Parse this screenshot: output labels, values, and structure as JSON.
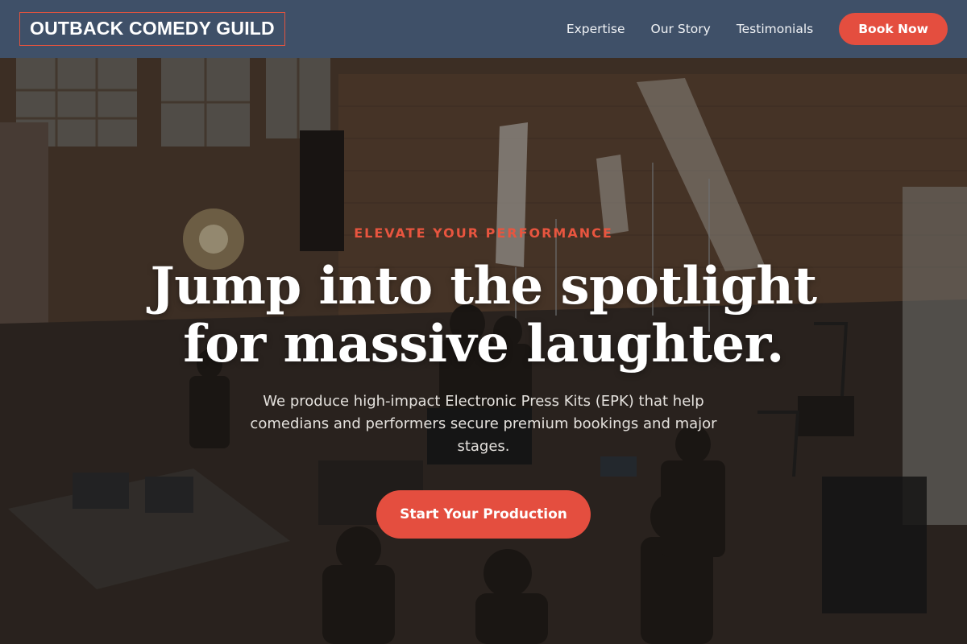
{
  "header": {
    "logo": "OUTBACK COMEDY GUILD",
    "nav": [
      {
        "label": "Expertise"
      },
      {
        "label": "Our Story"
      },
      {
        "label": "Testimonials"
      }
    ],
    "cta_label": "Book Now"
  },
  "hero": {
    "kicker": "ELEVATE YOUR PERFORMANCE",
    "headline_line1": "Jump into the spotlight",
    "headline_line2": "for massive laughter.",
    "subtext": "We produce high-impact Electronic Press Kits (EPK) that help comedians and performers secure premium bookings and major stages.",
    "cta_label": "Start Your Production",
    "background_image": "film crew in brick warehouse studio"
  },
  "colors": {
    "header_bg": "#3f5068",
    "accent": "#e44e3f",
    "kicker": "#e8553f",
    "text": "#ffffff"
  }
}
